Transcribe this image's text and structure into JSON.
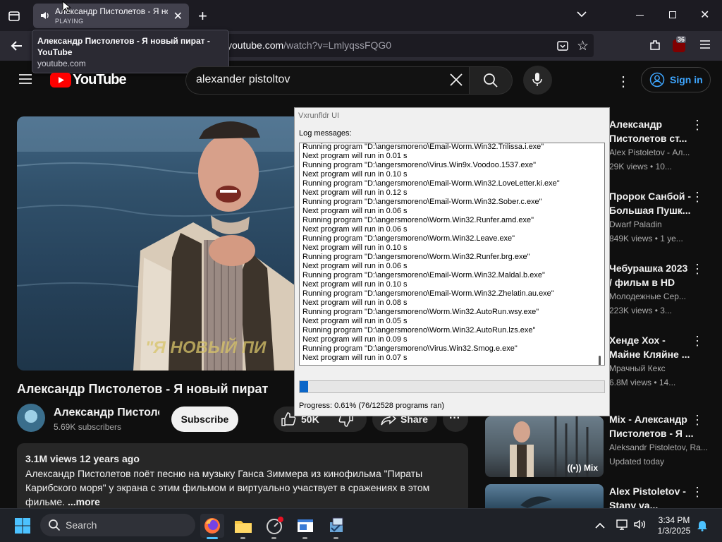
{
  "browser": {
    "tab_title": "Александр Пистолетов - Я новый пират",
    "tab_status": "PLAYING",
    "tooltip_title": "Александр Пистолетов - Я новый пират - YouTube",
    "tooltip_domain": "youtube.com",
    "url_host": "youtube.com",
    "url_path": "/watch?v=LmlyqssFQG0",
    "extension_badge": "36",
    "icons": [
      "speaker-icon",
      "close-tab-icon",
      "new-tab-icon",
      "tab-list-icon",
      "minimize-icon",
      "restore-icon",
      "close-window-icon",
      "back-icon",
      "reader-view-icon",
      "bookmark-star-icon",
      "extensions-icon",
      "ublock-icon",
      "menu-icon"
    ]
  },
  "youtube": {
    "logo_text": "YouTube",
    "search_value": "alexander pistoltov",
    "sign_in_label": "Sign in",
    "video_overlay_text": "\"Я НОВЫЙ   ПИ",
    "video_title": "Александр Пистолетов - Я новый пират",
    "channel_name": "Александр Пистолетов",
    "channel_subs": "5.69K subscribers",
    "subscribe_label": "Subscribe",
    "likes": "50K",
    "share_label": "Share",
    "views_date": "3.1M views  12 years ago",
    "description": "Александр Пистолетов поёт песню на музыку Ганса Зиммера из кинофильма \"Пираты Карибского моря\" у экрана с этим фильмом и виртуально участвует в сражениях в этом фильме.",
    "more_label": "...more",
    "recommendations": [
      {
        "title1": "Александр",
        "title2": "Пистолетов ст...",
        "channel": "Alex Pistoletov - Ал...",
        "views": "29K views  •  10..."
      },
      {
        "title1": "Пророк Санбой -",
        "title2": "Большая Пушк...",
        "channel": "Dwarf Paladin",
        "views": "849K views  •  1 уе..."
      },
      {
        "title1": "Чебурашка 2023",
        "title2": "/ фильм в HD",
        "channel": "Молодежные Сер...",
        "views": "223K views  •  3..."
      },
      {
        "title1": "Хенде Хох -",
        "title2": "Майне Кляйне ...",
        "channel": "Мрачный Кекс",
        "views": "6.8M views  •  14..."
      },
      {
        "title1": "Mix - Александр",
        "title2": "Пистолетов - Я ...",
        "channel": "Aleksandr Pistoletov, Ra...",
        "views": "Updated today"
      },
      {
        "title1": "Alex Pistoletov -",
        "title2": "Stany va...",
        "channel": "",
        "views": ""
      }
    ],
    "mix_badge": "Mix"
  },
  "dialog": {
    "title": "Vxrunfldr UI",
    "log_label": "Log messages:",
    "log_lines": [
      "Running program \"D:\\angersmoreno\\Email-Worm.Win32.Trilissa.i.exe\"",
      "Next program will run in 0.01 s",
      "Running program \"D:\\angersmoreno\\Virus.Win9x.Voodoo.1537.exe\"",
      "Next program will run in 0.10 s",
      "Running program \"D:\\angersmoreno\\Email-Worm.Win32.LoveLetter.ki.exe\"",
      "Next program will run in 0.12 s",
      "Running program \"D:\\angersmoreno\\Email-Worm.Win32.Sober.c.exe\"",
      "Next program will run in 0.06 s",
      "Running program \"D:\\angersmoreno\\Worm.Win32.Runfer.amd.exe\"",
      "Next program will run in 0.06 s",
      "Running program \"D:\\angersmoreno\\Worm.Win32.Leave.exe\"",
      "Next program will run in 0.10 s",
      "Running program \"D:\\angersmoreno\\Worm.Win32.Runfer.brg.exe\"",
      "Next program will run in 0.06 s",
      "Running program \"D:\\angersmoreno\\Email-Worm.Win32.Maldal.b.exe\"",
      "Next program will run in 0.10 s",
      "Running program \"D:\\angersmoreno\\Email-Worm.Win32.Zhelatin.au.exe\"",
      "Next program will run in 0.08 s",
      "Running program \"D:\\angersmoreno\\Worm.Win32.AutoRun.wsy.exe\"",
      "Next program will run in 0.05 s",
      "Running program \"D:\\angersmoreno\\Worm.Win32.AutoRun.lzs.exe\"",
      "Next program will run in 0.09 s",
      "Running program \"D:\\angersmoreno\\Virus.Win32.Smog.e.exe\"",
      "Next program will run in 0.07 s"
    ],
    "progress_fraction": 0.0061,
    "progress_text": "Progress: 0.61% (76/12528 programs ran)"
  },
  "taskbar": {
    "search_label": "Search",
    "time": "3:34 PM",
    "date": "1/3/2025",
    "icons": [
      "windows-start-icon",
      "search-icon",
      "firefox-icon",
      "file-explorer-icon",
      "recording-app-icon",
      "window-app-icon",
      "vxrunfldr-app-icon",
      "chevron-up-icon",
      "network-icon",
      "volume-icon",
      "notification-bell-icon"
    ]
  },
  "colors": {
    "youtube_red": "#ff0000",
    "link_blue": "#3ea6ff",
    "progress_blue": "#0b66c8",
    "notification_blue": "#3ea6ff"
  }
}
